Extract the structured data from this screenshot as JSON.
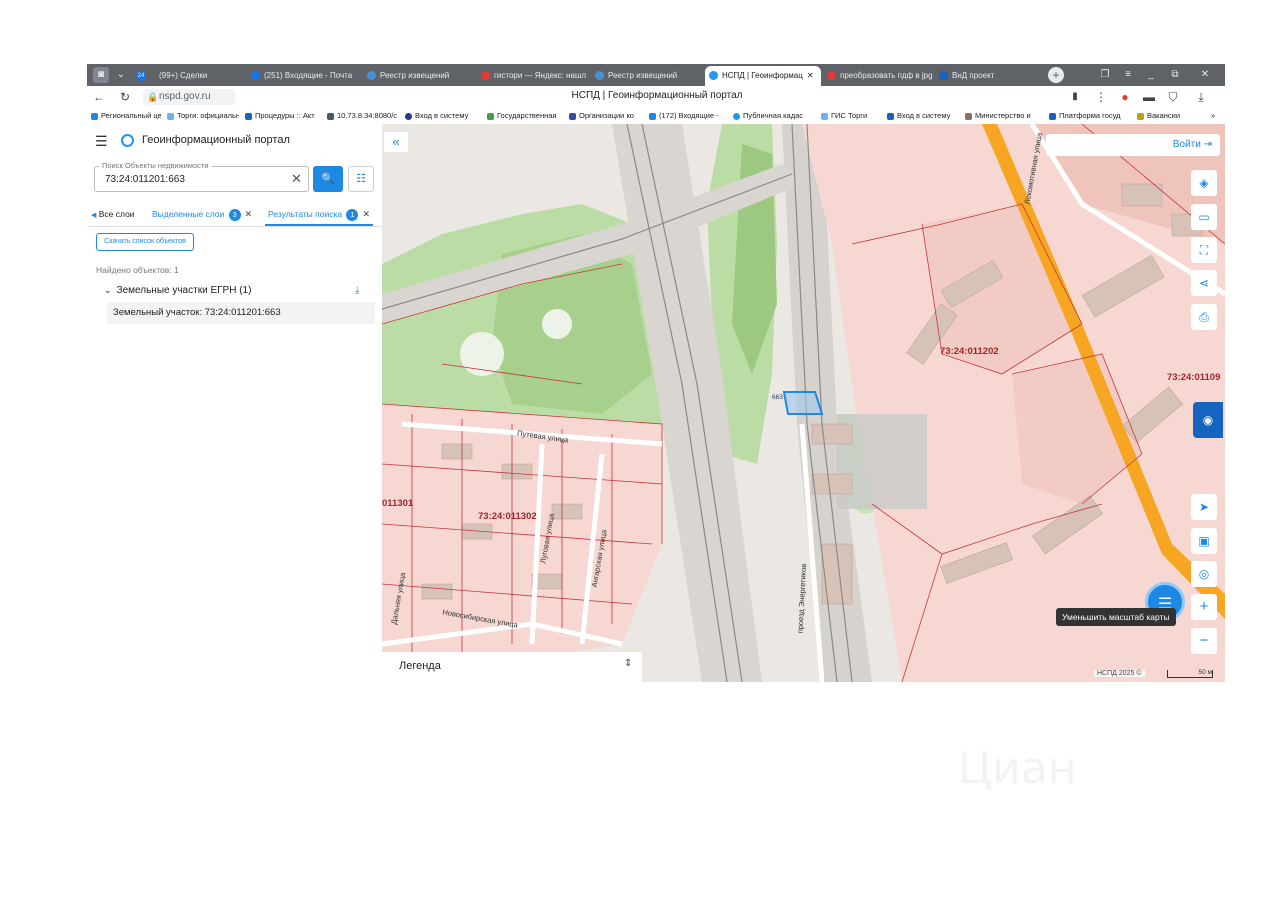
{
  "browser": {
    "tabs": [
      {
        "label": "(99+) Сделки"
      },
      {
        "label": "(251) Входящие - Почта"
      },
      {
        "label": "Реестр извещений"
      },
      {
        "label": "гистори — Яндекс: нашл"
      },
      {
        "label": "Реестр извещений"
      },
      {
        "label": "НСПД | Геоинформац"
      },
      {
        "label": "преобразовать пдф в jpg"
      },
      {
        "label": "ВнД проект"
      }
    ],
    "badge_count": "24",
    "url": "nspd.gov.ru",
    "page_title": "НСПД | Геоинформационный портал",
    "bookmarks": [
      {
        "label": "Региональный це"
      },
      {
        "label": "Торги: официальн"
      },
      {
        "label": "Процедуры :: Акт"
      },
      {
        "label": "10.73.8.34:8080/c"
      },
      {
        "label": "Вход в систему"
      },
      {
        "label": "Государственная"
      },
      {
        "label": "Организации ко"
      },
      {
        "label": "(172) Входящие -"
      },
      {
        "label": "Публичная кадас"
      },
      {
        "label": "ГИС Торги"
      },
      {
        "label": "Вход в систему"
      },
      {
        "label": "Министерство и"
      },
      {
        "label": "Платформа госуд"
      },
      {
        "label": "Вакансии"
      }
    ]
  },
  "panel": {
    "title": "Геоинформационный портал",
    "search_legend": "Поиск Объекты недвижимости",
    "search_value": "73:24:011201:663",
    "tabs": {
      "all": "Все слои",
      "selected": "Выделенные слои",
      "selected_count": "3",
      "results": "Результаты поиска",
      "results_count": "1"
    },
    "download_label": "Скачать список объектов",
    "found_text": "Найдено объектов: 1",
    "group_label": "Земельные участки ЕГРН (1)",
    "result_item": "Земельный участок: 73:24:011201:663"
  },
  "map": {
    "login_label": "Войти",
    "legend_label": "Легенда",
    "tooltip": "Уменьшить масштаб карты",
    "copyright": "НСПД 2025 ©",
    "scale": "50 м",
    "quarters": [
      "73:24:011202",
      "73:24:011302",
      "73:24:01109",
      "011301"
    ],
    "parcel": "663",
    "streets": [
      "Путевая улица",
      "Луговая улица",
      "Ангарская улица",
      "Новосибирская улица",
      "проезд Энергетиков",
      "Локомотивная улица",
      "Дальняя улица"
    ]
  },
  "watermark": "Циан"
}
